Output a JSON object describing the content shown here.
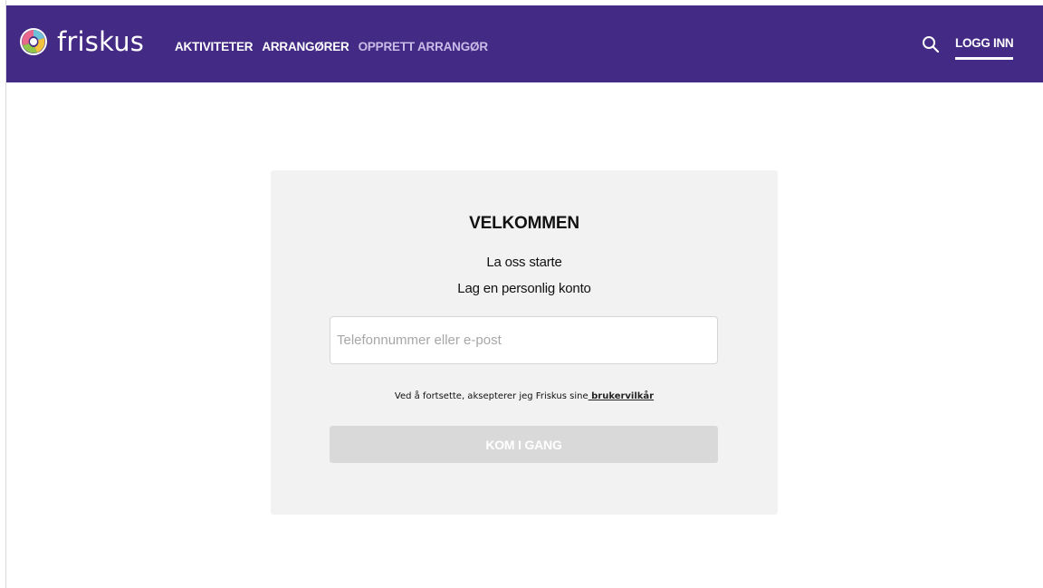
{
  "brand": {
    "name": "friskus",
    "logo_icon": "friskus-logo-icon"
  },
  "nav": {
    "items": [
      {
        "label": "AKTIVITETER"
      },
      {
        "label": "ARRANGØRER"
      },
      {
        "label": "OPPRETT ARRANGØR"
      }
    ],
    "search_icon": "search-icon",
    "login_label": "LOGG INN"
  },
  "signup": {
    "title": "VELKOMMEN",
    "line1": "La oss starte",
    "line2": "Lag en personlig konto",
    "input_placeholder": "Telefonnummer eller e-post",
    "input_value": "",
    "terms_text": "Ved å fortsette, aksepterer jeg Friskus sine",
    "terms_link": " brukervilkår",
    "cta_label": "KOM I GANG"
  },
  "colors": {
    "header_bg": "#432a85",
    "card_bg": "#f2f2f2",
    "button_disabled": "#d9d9d9",
    "nav_muted": "#c9bde8"
  }
}
